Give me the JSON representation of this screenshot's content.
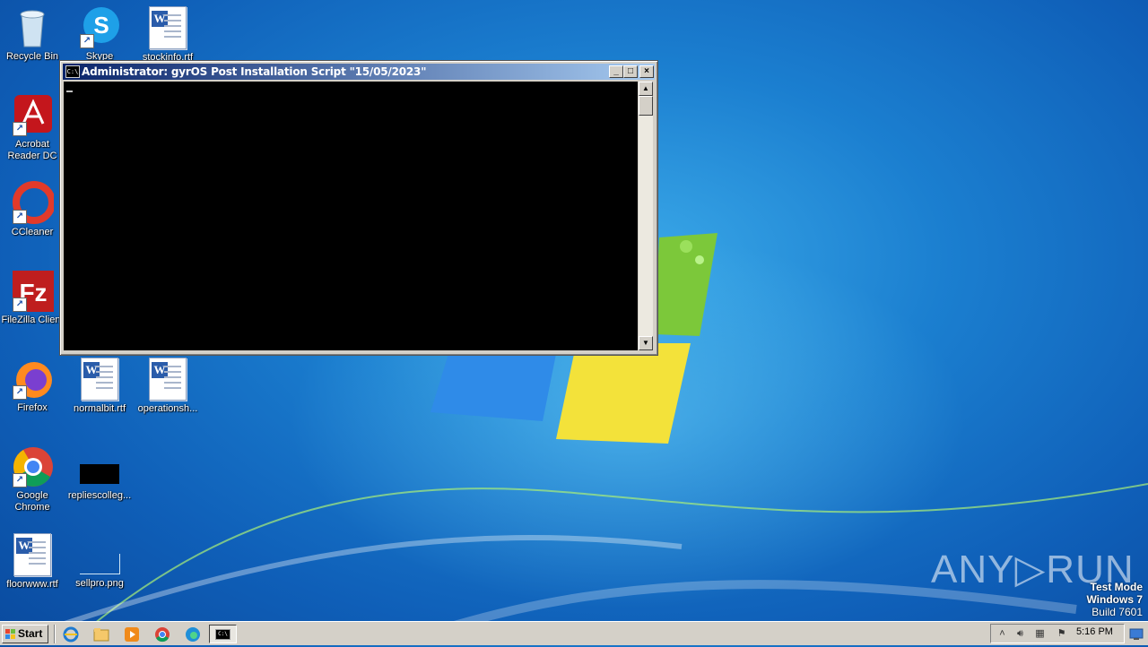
{
  "desktop": {
    "icons": [
      {
        "label": "Recycle Bin"
      },
      {
        "label": "Skype"
      },
      {
        "label": "stockinfo.rtf"
      },
      {
        "label": "Acrobat Reader DC"
      },
      {
        "label": "CCleaner"
      },
      {
        "label": "FileZilla Client"
      },
      {
        "label": "Firefox"
      },
      {
        "label": "normalbit.rtf"
      },
      {
        "label": "operationsh..."
      },
      {
        "label": "Google Chrome"
      },
      {
        "label": "repliescolleg..."
      },
      {
        "label": "floorwww.rtf"
      },
      {
        "label": "sellpro.png"
      }
    ]
  },
  "console_window": {
    "title": "Administrator:  gyrOS Post Installation Script \"15/05/2023\"",
    "icon_text": "C:\\",
    "buttons": {
      "minimize": "_",
      "maximize": "□",
      "close": "×"
    }
  },
  "watermark": {
    "brand": "ANY▷RUN",
    "test_mode": "Test Mode",
    "os": "Windows 7",
    "build": "Build 7601"
  },
  "taskbar": {
    "start_label": "Start",
    "quick_launch": [
      "internet-explorer-icon",
      "explorer-icon",
      "media-player-icon",
      "chrome-icon",
      "edge-icon"
    ],
    "active_task_icon": "C:\\",
    "clock": "5:16 PM"
  },
  "colors": {
    "wallpaper": "#1b7fd0",
    "titlebar_start": "#0a246a",
    "titlebar_end": "#a6caf0",
    "console_bg": "#000000"
  }
}
